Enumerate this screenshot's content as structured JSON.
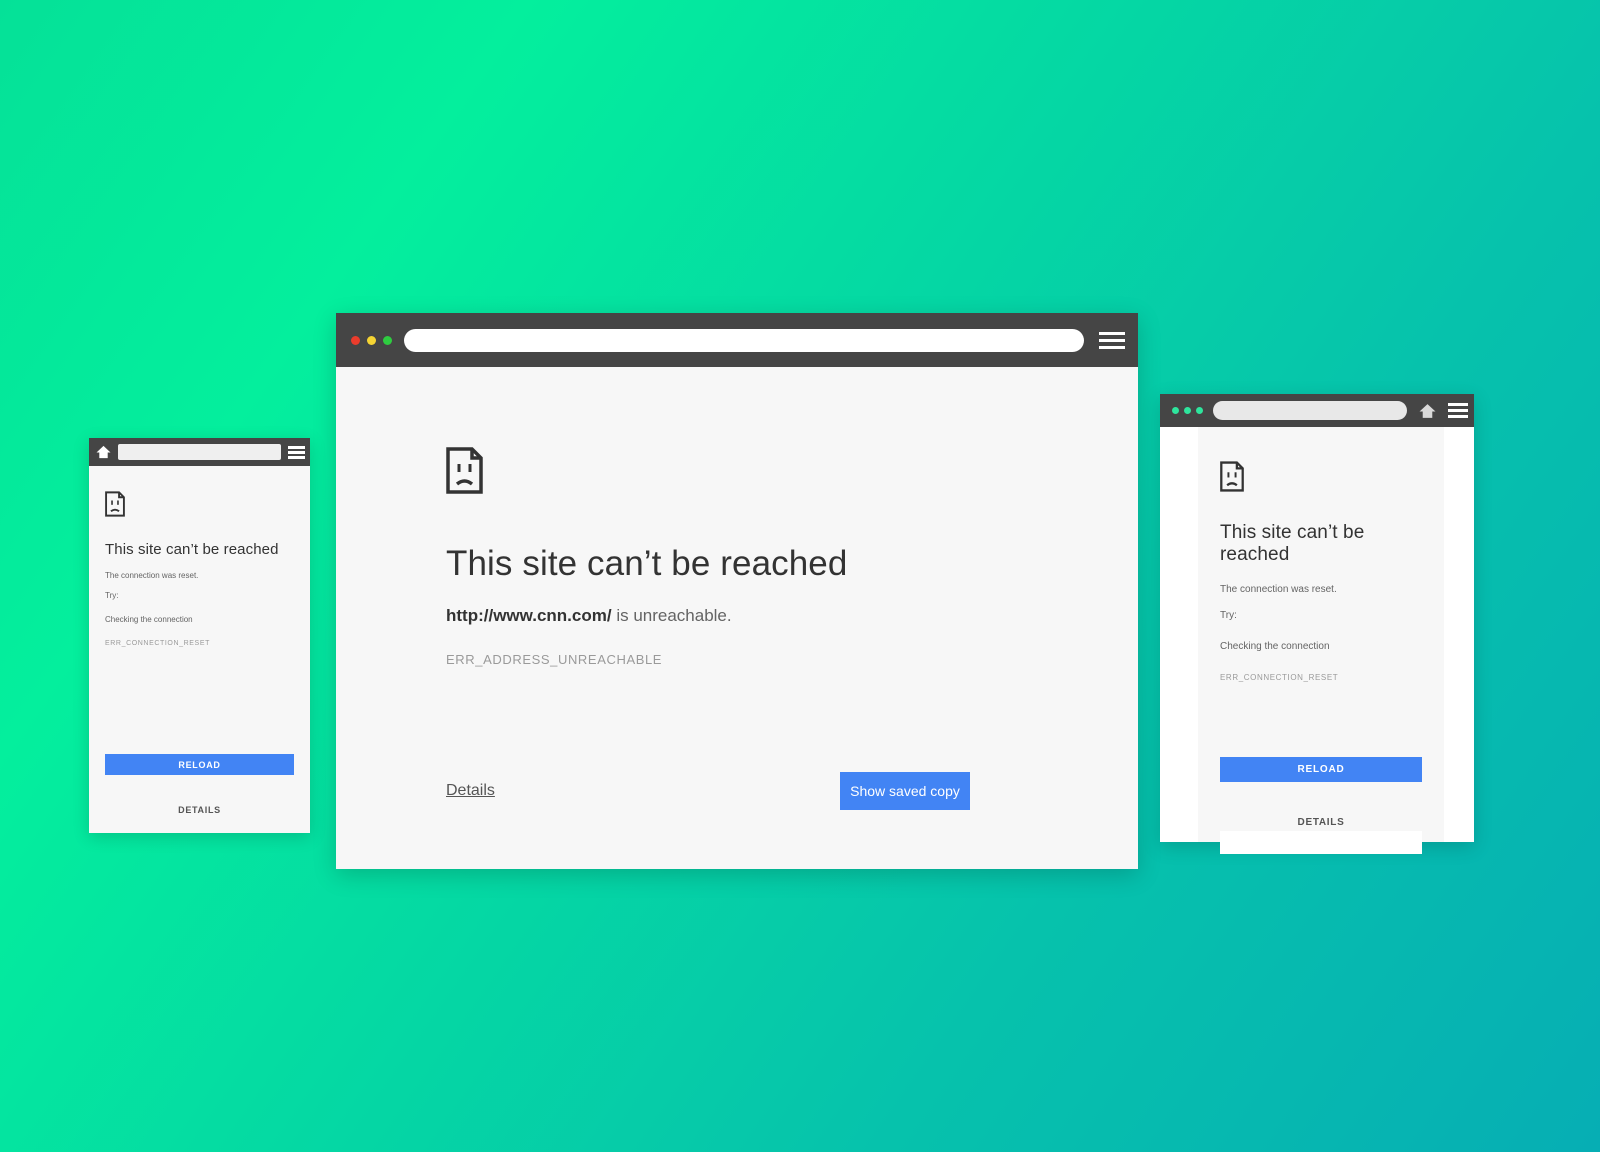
{
  "background": {
    "gradient_from": "#05e198",
    "gradient_to": "#06aeb4"
  },
  "theme": {
    "toolbar_bg": "#454545",
    "page_bg": "#f7f7f7",
    "primary_button": "#4284f4",
    "headline_color": "#333333",
    "body_color": "#646464",
    "errcode_color": "#9a9a9a",
    "dot_red": "#ea3c2c",
    "dot_yellow": "#f5d433",
    "dot_green": "#2ecc40",
    "dot_tablet": "#2ee59d"
  },
  "desktop": {
    "toolbar": {
      "url_value": "",
      "url_placeholder": "",
      "menu_label": "Menu",
      "dots": [
        "close",
        "minimize",
        "maximize"
      ]
    },
    "content": {
      "icon": "sad-page-icon",
      "headline": "This site can’t be reached",
      "url": "http://www.cnn.com/",
      "body_suffix": " is unreachable.",
      "error_code": "ERR_ADDRESS_UNREACHABLE",
      "details_label": "Details",
      "primary_button_label": "Show saved copy"
    }
  },
  "mobile": {
    "toolbar": {
      "home_label": "Home",
      "url_value": "",
      "url_placeholder": "",
      "menu_label": "Menu"
    },
    "content": {
      "icon": "sad-page-icon",
      "headline": "This site can’t be reached",
      "reason": "The connection was reset.",
      "try_label": "Try:",
      "try_suggestion": "Checking the connection",
      "error_code": "ERR_CONNECTION_RESET",
      "primary_button_label": "RELOAD",
      "details_label": "DETAILS"
    }
  },
  "tablet": {
    "toolbar": {
      "dots": [
        "close",
        "minimize",
        "maximize"
      ],
      "url_value": "",
      "url_placeholder": "",
      "home_label": "Home",
      "menu_label": "Menu"
    },
    "content": {
      "icon": "sad-page-icon",
      "headline": "This site can’t be reached",
      "reason": "The connection was reset.",
      "try_label": "Try:",
      "try_suggestion": "Checking the connection",
      "error_code": "ERR_CONNECTION_RESET",
      "primary_button_label": "RELOAD",
      "details_label": "DETAILS"
    }
  }
}
